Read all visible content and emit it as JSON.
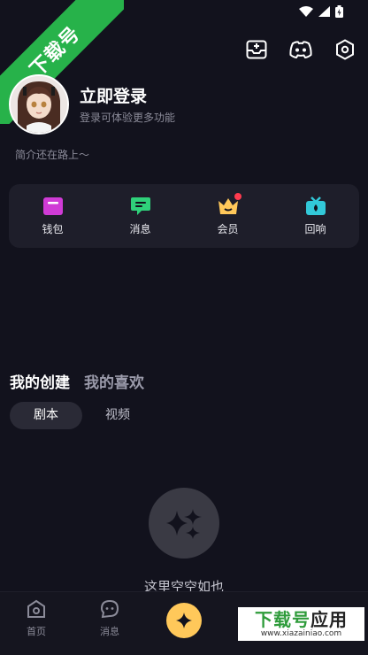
{
  "corner_ribbon": {
    "text": "下载号"
  },
  "header": {
    "title": "立即登录",
    "subtitle": "登录可体验更多功能",
    "bio": "简介还在路上～"
  },
  "top_actions": [
    "inbox-add-icon",
    "discord-icon",
    "settings-icon"
  ],
  "quick_actions": [
    {
      "label": "钱包",
      "icon": "wallet-icon",
      "color": "#d03bd6"
    },
    {
      "label": "消息",
      "icon": "chat-icon",
      "color": "#2fd17a"
    },
    {
      "label": "会员",
      "icon": "crown-icon",
      "color": "#ffc85a",
      "badge": true
    },
    {
      "label": "回响",
      "icon": "echo-icon",
      "color": "#32c8d8"
    }
  ],
  "content_tabs": [
    {
      "label": "我的创建",
      "active": true
    },
    {
      "label": "我的喜欢",
      "active": false
    }
  ],
  "sub_tabs": [
    {
      "label": "剧本",
      "active": true
    },
    {
      "label": "视频",
      "active": false
    }
  ],
  "empty_state": {
    "text": "这里空空如也"
  },
  "bottom_nav": [
    {
      "label": "首页",
      "icon": "home-icon"
    },
    {
      "label": "消息",
      "icon": "chat-bubble-icon"
    },
    {
      "label": "",
      "icon": "sparkle-icon"
    }
  ],
  "watermark": {
    "brand_green": "下载号",
    "brand_dark": "应用",
    "url": "www.xiazainiao.com"
  },
  "colors": {
    "background": "#12121d",
    "panel": "#1e1e2a",
    "accent": "#ffc85a",
    "ribbon": "#27b24a"
  }
}
